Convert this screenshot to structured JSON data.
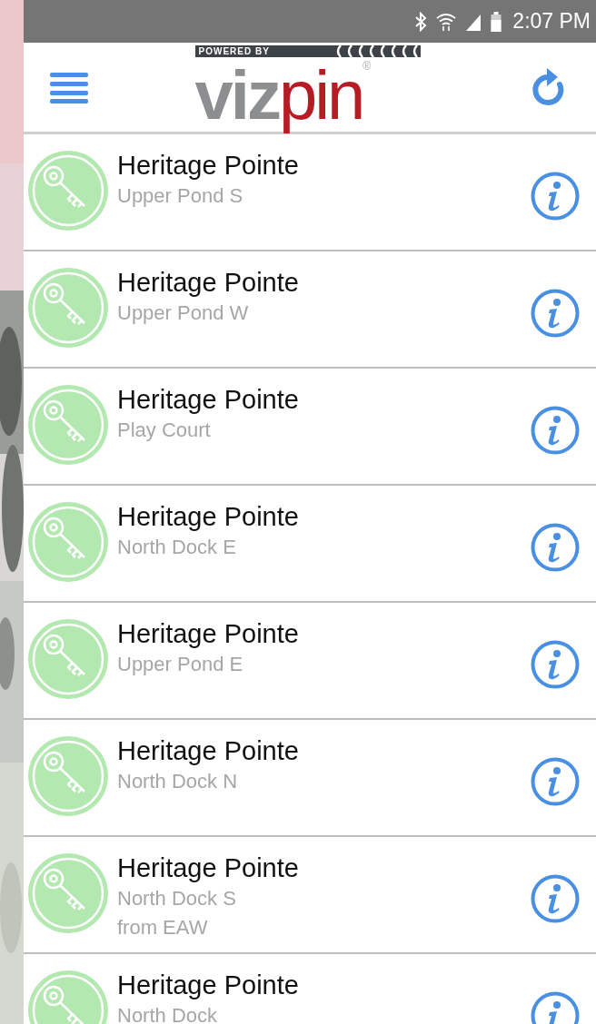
{
  "status_bar": {
    "time": "2:07 PM"
  },
  "header": {
    "logo": {
      "tagline": "POWERED BY",
      "wordmark_gray": "viz",
      "wordmark_red": "pin",
      "registered": "®"
    }
  },
  "locks": [
    {
      "title": "Heritage Pointe",
      "subtitle": "Upper Pond S"
    },
    {
      "title": "Heritage Pointe",
      "subtitle": "Upper Pond W"
    },
    {
      "title": "Heritage Pointe",
      "subtitle": "Play Court"
    },
    {
      "title": "Heritage Pointe",
      "subtitle": "North Dock E"
    },
    {
      "title": "Heritage Pointe",
      "subtitle": "Upper Pond E"
    },
    {
      "title": "Heritage Pointe",
      "subtitle": "North Dock N"
    },
    {
      "title": "Heritage Pointe",
      "subtitle": "North Dock S",
      "detail": "from EAW"
    },
    {
      "title": "Heritage Pointe",
      "subtitle": "North Dock"
    }
  ]
}
